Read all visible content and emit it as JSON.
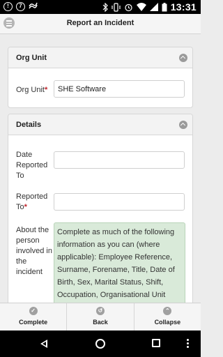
{
  "status_bar": {
    "time": "13:31",
    "left_icons": [
      "notification-badge-icon",
      "notification-7-icon",
      "usb-icon"
    ],
    "left_badge_text": "",
    "left_badge_number": "7",
    "right_icons": [
      "bluetooth-icon",
      "vibrate-icon",
      "alarm-icon",
      "wifi-icon",
      "signal-icon",
      "battery-icon"
    ]
  },
  "header": {
    "title": "Report an Incident",
    "menu_icon": "menu-icon"
  },
  "sections": {
    "org_unit": {
      "title": "Org Unit",
      "field_label": "Org Unit",
      "field_value": "SHE Software",
      "required_mark": "*"
    },
    "details": {
      "title": "Details",
      "date_reported_to_label": "Date Reported To",
      "date_reported_to_value": "",
      "reported_to_label": "Reported To",
      "reported_to_value": "",
      "required_mark": "*",
      "person_label": "About the person involved in the incident",
      "person_note": "Complete as much of the following information as you can (where applicable): Employee Reference, Surname, Forename, Title, Date of Birth, Sex, Marital Status, Shift, Occupation, Organisational Unit"
    }
  },
  "toolbar": {
    "complete_label": "Complete",
    "back_label": "Back",
    "collapse_label": "Collapse"
  },
  "colors": {
    "note_background": "#d9ead9",
    "required": "#c0262d",
    "header_background": "#f5f5f5"
  }
}
